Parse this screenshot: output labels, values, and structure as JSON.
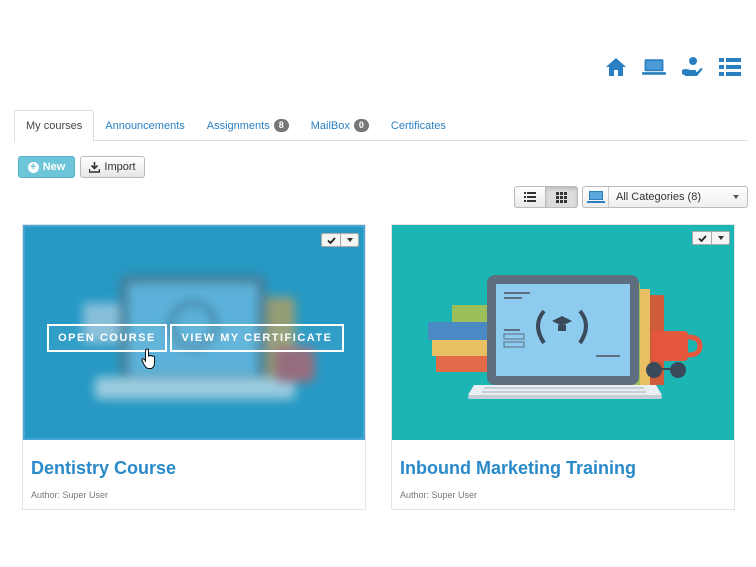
{
  "top_icons": [
    "home-icon",
    "laptop-icon",
    "hand-course-icon",
    "list-icon"
  ],
  "tabs": [
    {
      "label": "My courses",
      "badge": null,
      "active": true
    },
    {
      "label": "Announcements",
      "badge": null
    },
    {
      "label": "Assignments",
      "badge": "8"
    },
    {
      "label": "MailBox",
      "badge": "0"
    },
    {
      "label": "Certificates",
      "badge": null
    }
  ],
  "toolbar": {
    "new_label": "New",
    "import_label": "Import"
  },
  "filter": {
    "category_label": "All Categories (8)"
  },
  "cards": [
    {
      "title": "Dentistry Course",
      "author": "Author: Super User",
      "open_label": "OPEN COURSE",
      "certificate_label": "VIEW MY CERTIFICATE"
    },
    {
      "title": "Inbound Marketing Training",
      "author": "Author: Super User"
    }
  ],
  "colors": {
    "accent": "#2a8ac9",
    "new_button": "#6cc5d8",
    "card1_bg": "#2699c4",
    "card2_bg": "#1bb5b3"
  }
}
